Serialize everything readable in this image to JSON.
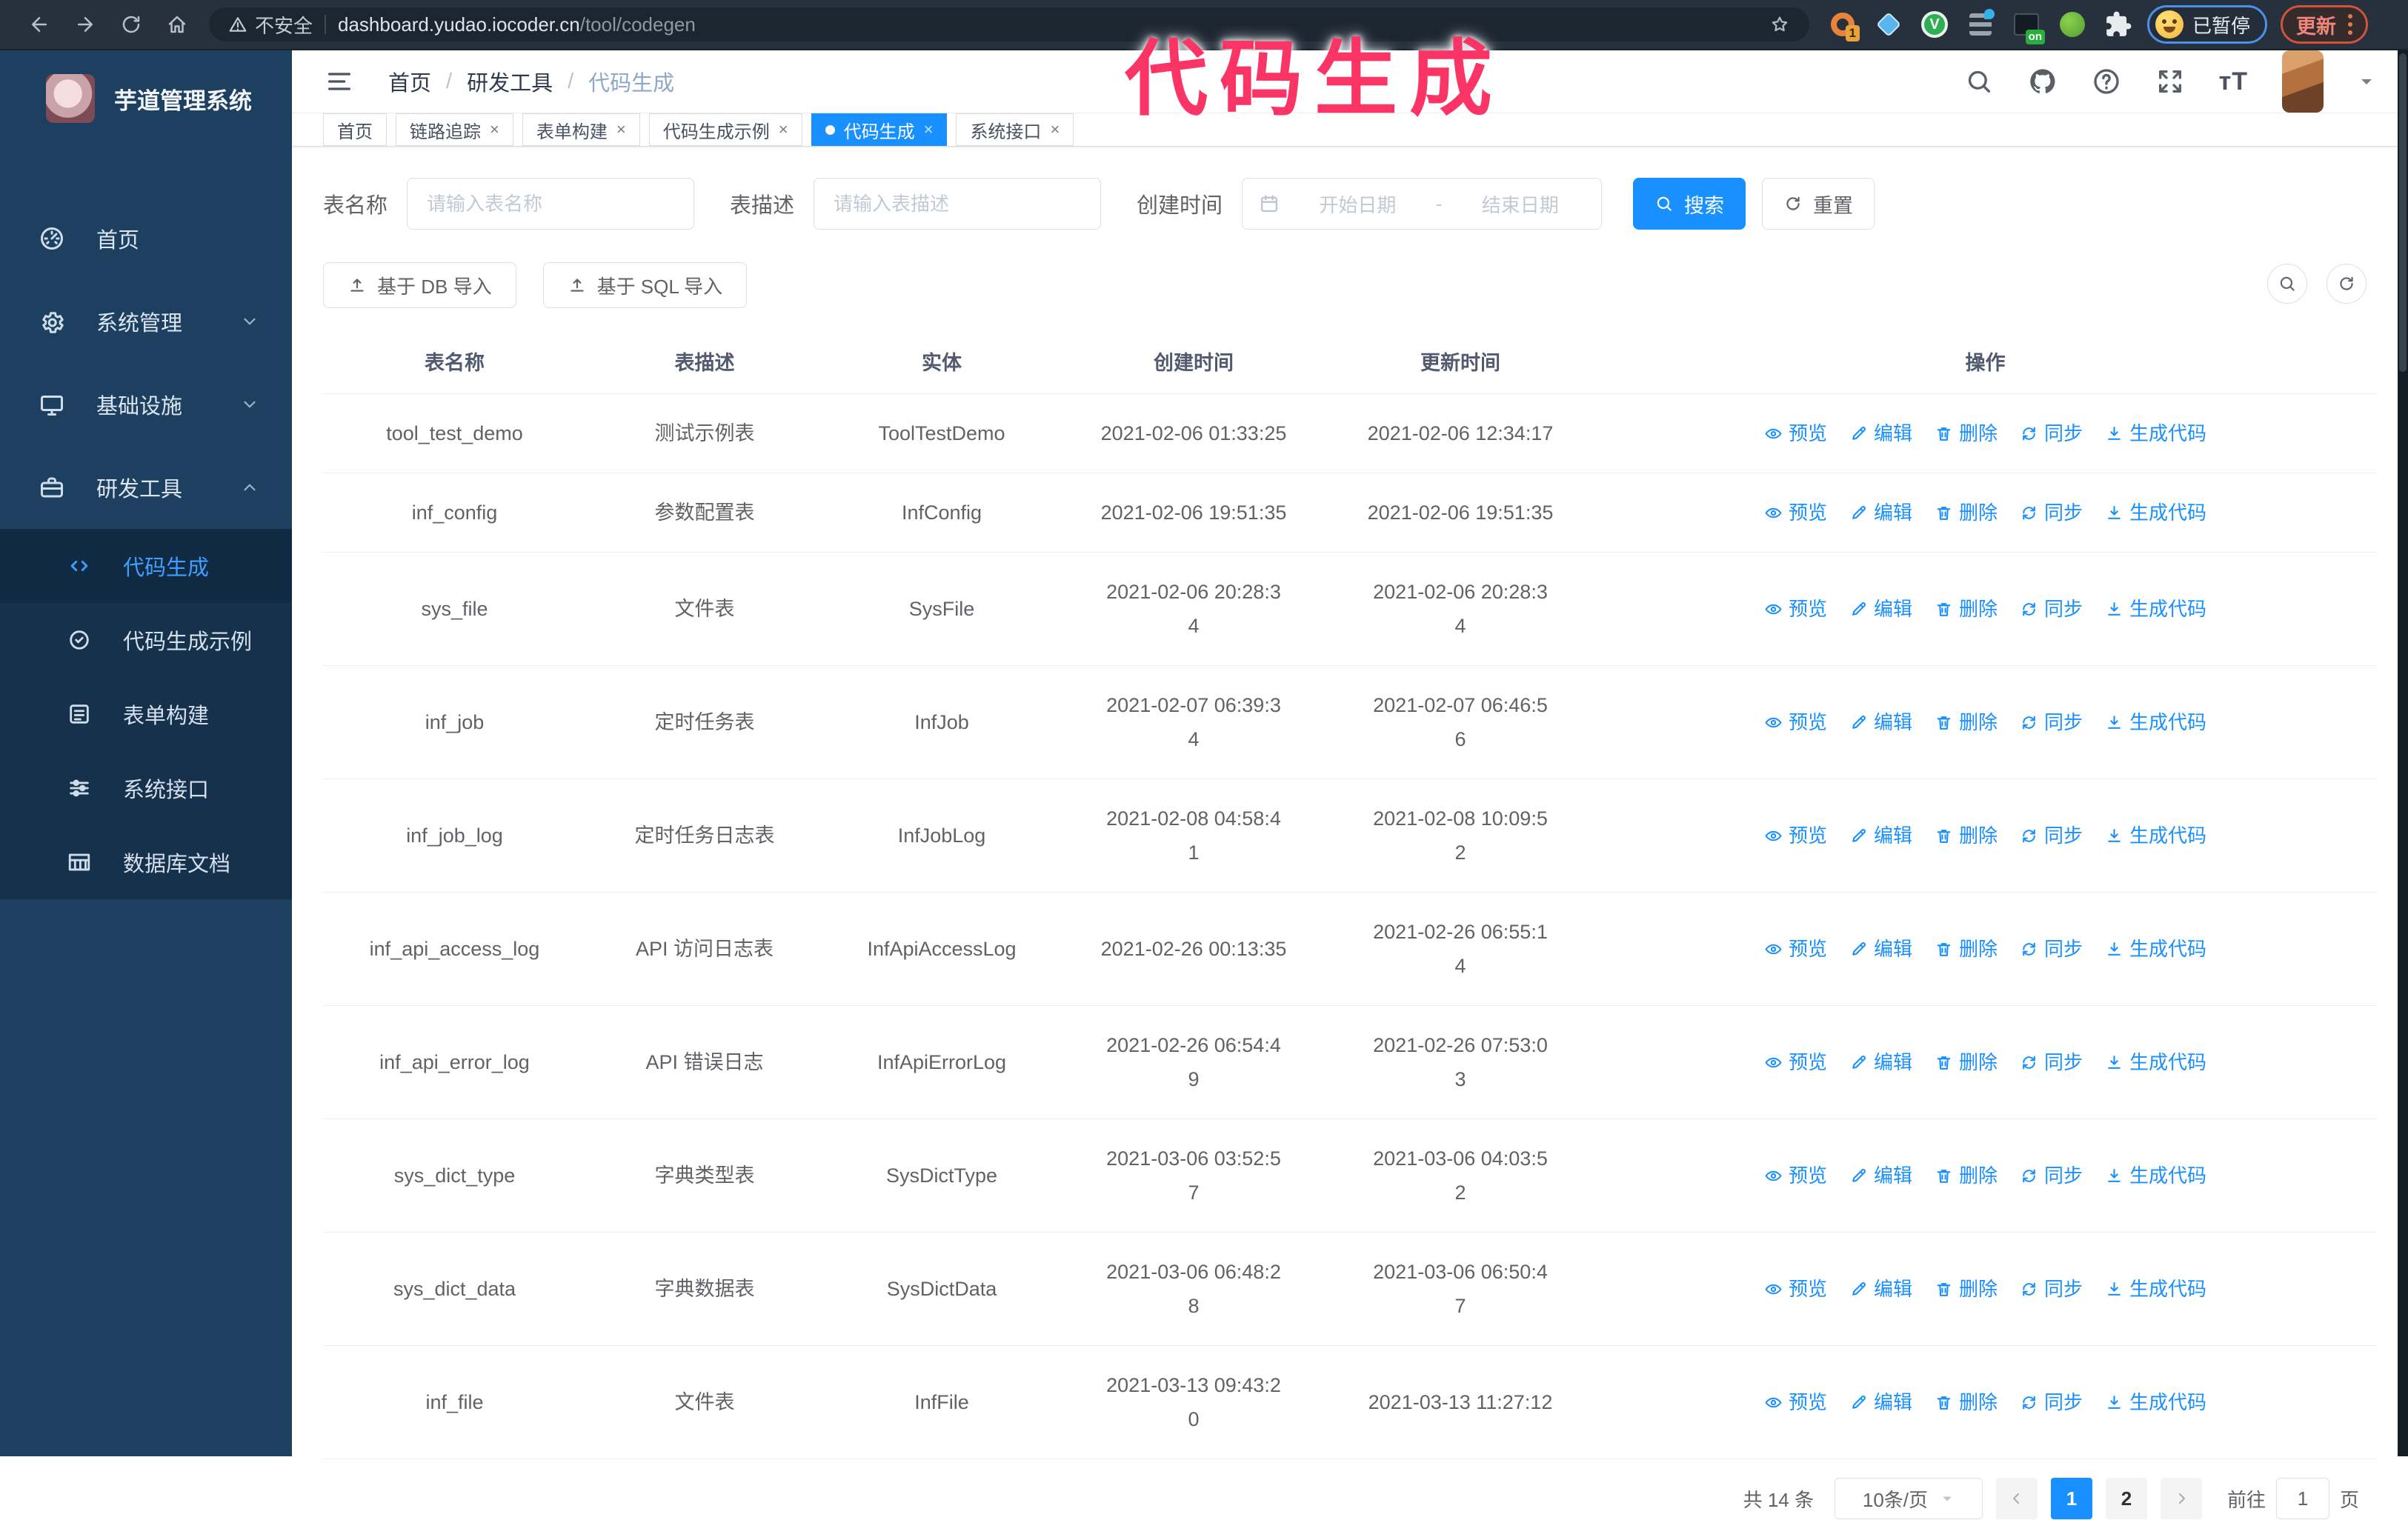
{
  "browser": {
    "security_label": "不安全",
    "url_host": "dashboard.yudao.iocoder.cn",
    "url_path": "/tool/codegen",
    "extension_badges": {
      "orange": "1",
      "dark": "on"
    },
    "paused_label": "已暂停",
    "update_label": "更新"
  },
  "overlay_title": "代码生成",
  "sidebar": {
    "app_title": "芋道管理系统",
    "items": [
      {
        "label": "首页",
        "icon": "gauge",
        "expand": ""
      },
      {
        "label": "系统管理",
        "icon": "gear",
        "expand": "down"
      },
      {
        "label": "基础设施",
        "icon": "monitor",
        "expand": "down"
      },
      {
        "label": "研发工具",
        "icon": "toolbox",
        "expand": "up"
      }
    ],
    "subitems": [
      {
        "label": "代码生成",
        "icon": "code",
        "active": true
      },
      {
        "label": "代码生成示例",
        "icon": "badge",
        "active": false
      },
      {
        "label": "表单构建",
        "icon": "form",
        "active": false
      },
      {
        "label": "系统接口",
        "icon": "sliders",
        "active": false
      },
      {
        "label": "数据库文档",
        "icon": "dbtable",
        "active": false
      }
    ]
  },
  "breadcrumb": [
    "首页",
    "研发工具",
    "代码生成"
  ],
  "tabs": [
    {
      "label": "首页",
      "closable": false,
      "active": false
    },
    {
      "label": "链路追踪",
      "closable": true,
      "active": false
    },
    {
      "label": "表单构建",
      "closable": true,
      "active": false
    },
    {
      "label": "代码生成示例",
      "closable": true,
      "active": false
    },
    {
      "label": "代码生成",
      "closable": true,
      "active": true
    },
    {
      "label": "系统接口",
      "closable": true,
      "active": false
    }
  ],
  "filters": {
    "table_name_label": "表名称",
    "table_name_placeholder": "请输入表名称",
    "table_desc_label": "表描述",
    "table_desc_placeholder": "请输入表描述",
    "create_time_label": "创建时间",
    "date_start_placeholder": "开始日期",
    "date_separator": "-",
    "date_end_placeholder": "结束日期",
    "search_label": "搜索",
    "reset_label": "重置"
  },
  "toolbar": {
    "import_db_label": "基于 DB 导入",
    "import_sql_label": "基于 SQL 导入"
  },
  "table": {
    "columns": [
      "表名称",
      "表描述",
      "实体",
      "创建时间",
      "更新时间",
      "操作"
    ],
    "action_labels": [
      "预览",
      "编辑",
      "删除",
      "同步",
      "生成代码"
    ],
    "action_icons": [
      "eye",
      "edit",
      "trash",
      "sync",
      "download"
    ],
    "rows": [
      {
        "name": "tool_test_demo",
        "desc": "测试示例表",
        "entity": "ToolTestDemo",
        "created": "2021-02-06 01:33:25",
        "updated": "2021-02-06 12:34:17"
      },
      {
        "name": "inf_config",
        "desc": "参数配置表",
        "entity": "InfConfig",
        "created": "2021-02-06 19:51:35",
        "updated": "2021-02-06 19:51:35"
      },
      {
        "name": "sys_file",
        "desc": "文件表",
        "entity": "SysFile",
        "created": "2021-02-06 20:28:3\n4",
        "updated": "2021-02-06 20:28:3\n4"
      },
      {
        "name": "inf_job",
        "desc": "定时任务表",
        "entity": "InfJob",
        "created": "2021-02-07 06:39:3\n4",
        "updated": "2021-02-07 06:46:5\n6"
      },
      {
        "name": "inf_job_log",
        "desc": "定时任务日志表",
        "entity": "InfJobLog",
        "created": "2021-02-08 04:58:4\n1",
        "updated": "2021-02-08 10:09:5\n2"
      },
      {
        "name": "inf_api_access_log",
        "desc": "API 访问日志表",
        "entity": "InfApiAccessLog",
        "created": "2021-02-26 00:13:35",
        "updated": "2021-02-26 06:55:1\n4"
      },
      {
        "name": "inf_api_error_log",
        "desc": "API 错误日志",
        "entity": "InfApiErrorLog",
        "created": "2021-02-26 06:54:4\n9",
        "updated": "2021-02-26 07:53:0\n3"
      },
      {
        "name": "sys_dict_type",
        "desc": "字典类型表",
        "entity": "SysDictType",
        "created": "2021-03-06 03:52:5\n7",
        "updated": "2021-03-06 04:03:5\n2"
      },
      {
        "name": "sys_dict_data",
        "desc": "字典数据表",
        "entity": "SysDictData",
        "created": "2021-03-06 06:48:2\n8",
        "updated": "2021-03-06 06:50:4\n7"
      },
      {
        "name": "inf_file",
        "desc": "文件表",
        "entity": "InfFile",
        "created": "2021-03-13 09:43:2\n0",
        "updated": "2021-03-13 11:27:12"
      }
    ]
  },
  "pagination": {
    "total_label": "共 14 条",
    "page_size": "10条/页",
    "pages": [
      "1",
      "2"
    ],
    "active_page": "1",
    "goto_label": "前往",
    "goto_value": "1",
    "page_suffix_label": "页"
  }
}
